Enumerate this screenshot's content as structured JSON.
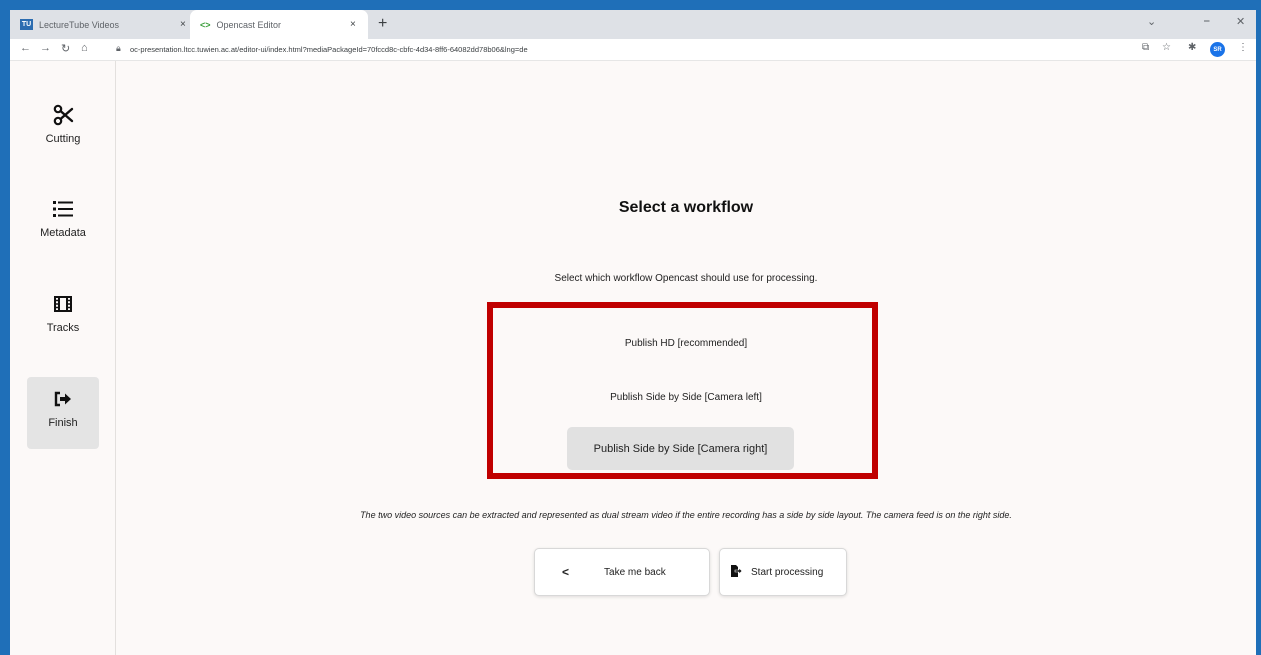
{
  "browser": {
    "tabs": [
      {
        "favicon": "TU",
        "title": "LectureTube Videos",
        "close": "×"
      },
      {
        "favicon": "<>",
        "title": "Opencast Editor",
        "close": "×"
      }
    ],
    "new_tab": "+",
    "window_controls": {
      "chevron": "⌄",
      "minimize": "⎯",
      "close": "✕"
    },
    "url": "oc-presentation.ltcc.tuwien.ac.at/editor-ui/index.html?mediaPackageId=70fccd8c-cbfc-4d34-8ff6-64082dd78b06&lng=de",
    "avatar": "SR"
  },
  "sidebar": {
    "items": [
      {
        "label": "Cutting",
        "icon": "scissors-icon"
      },
      {
        "label": "Metadata",
        "icon": "list-icon"
      },
      {
        "label": "Tracks",
        "icon": "film-icon"
      },
      {
        "label": "Finish",
        "icon": "sign-out-icon"
      }
    ]
  },
  "main": {
    "title": "Select a workflow",
    "subtitle": "Select which workflow Opencast should use for processing.",
    "workflows": [
      {
        "label": "Publish HD [recommended]"
      },
      {
        "label": "Publish Side by Side [Camera left]"
      },
      {
        "label": "Publish Side by Side [Camera right]"
      }
    ],
    "selected_workflow_index": 2,
    "description": "The two video sources can be extracted and represented as dual stream video if the entire recording has a side by side layout. The camera feed is on the right side.",
    "back_button": "Take me back",
    "start_button": "Start processing"
  },
  "colors": {
    "highlight_border": "#c00000",
    "frame_border": "#1f6fb8",
    "selected_option": "#e1e1e1"
  }
}
